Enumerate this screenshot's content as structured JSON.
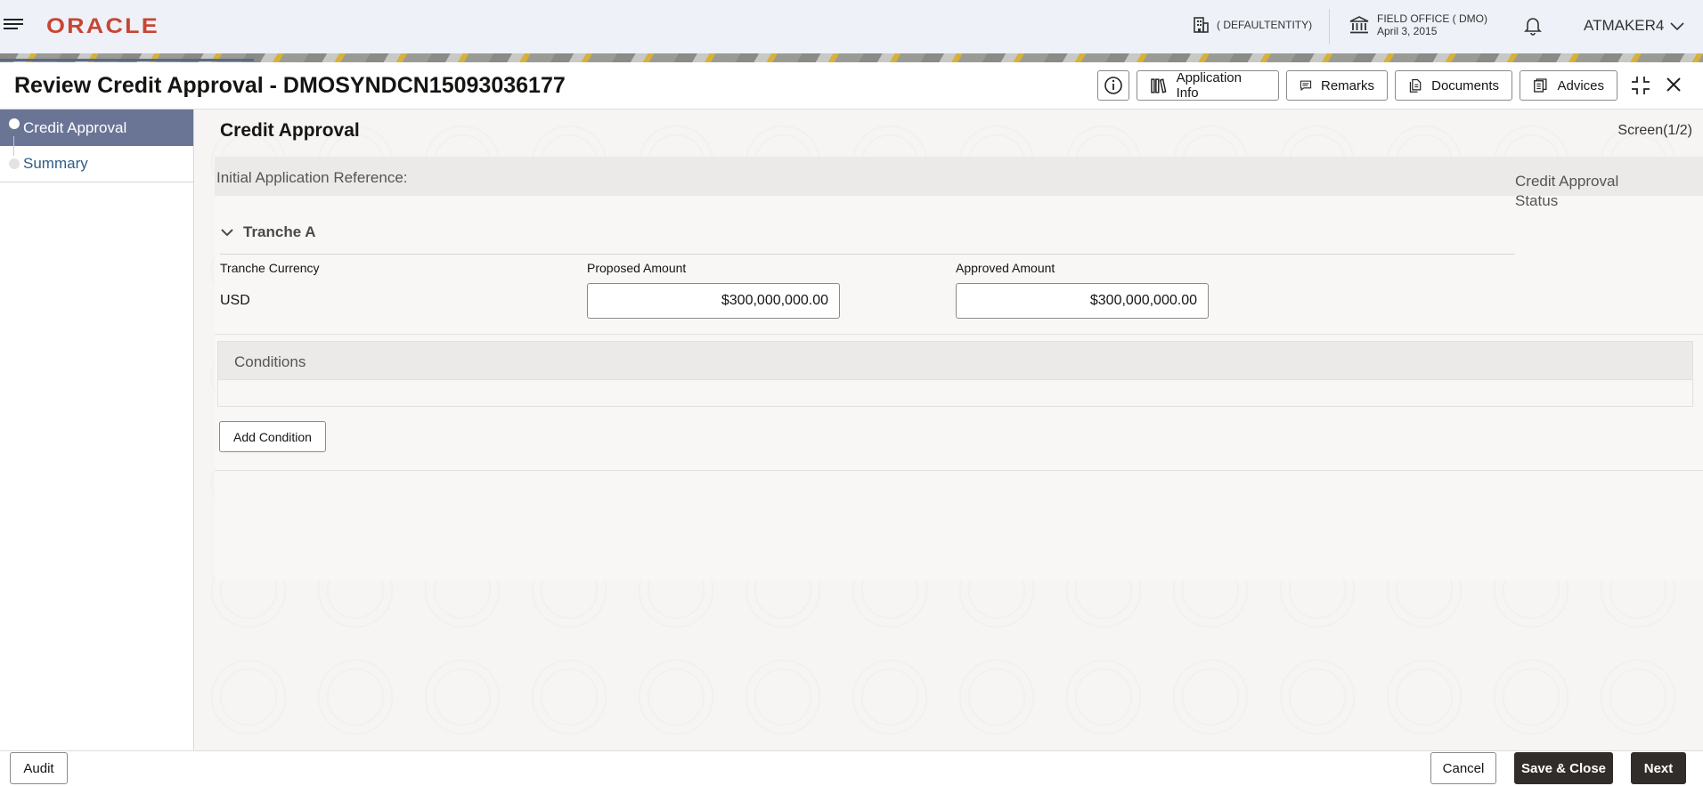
{
  "header": {
    "logo": "ORACLE",
    "entity": "( DEFAULTENTITY)",
    "office_name": "FIELD OFFICE ( DMO)",
    "office_date": "April 3, 2015",
    "user": "ATMAKER4"
  },
  "titlebar": {
    "title": "Review Credit Approval - DMOSYNDCN15093036177",
    "buttons": {
      "application_info": "Application Info",
      "remarks": "Remarks",
      "documents": "Documents",
      "advices": "Advices"
    }
  },
  "sidebar": {
    "items": [
      {
        "label": "Credit Approval",
        "active": true
      },
      {
        "label": "Summary",
        "active": false
      }
    ]
  },
  "main": {
    "section_title": "Credit Approval",
    "screen_counter": "Screen(1/2)",
    "initial_reference_label": "Initial Application Reference:",
    "status_label": "Credit Approval Status",
    "tranche": {
      "title": "Tranche A",
      "currency_label": "Tranche Currency",
      "currency_value": "USD",
      "proposed_label": "Proposed Amount",
      "proposed_value": "$300,000,000.00",
      "approved_label": "Approved Amount",
      "approved_value": "$300,000,000.00"
    },
    "conditions_label": "Conditions",
    "add_condition": "Add Condition"
  },
  "footer": {
    "audit": "Audit",
    "cancel": "Cancel",
    "save_close": "Save & Close",
    "next": "Next"
  }
}
